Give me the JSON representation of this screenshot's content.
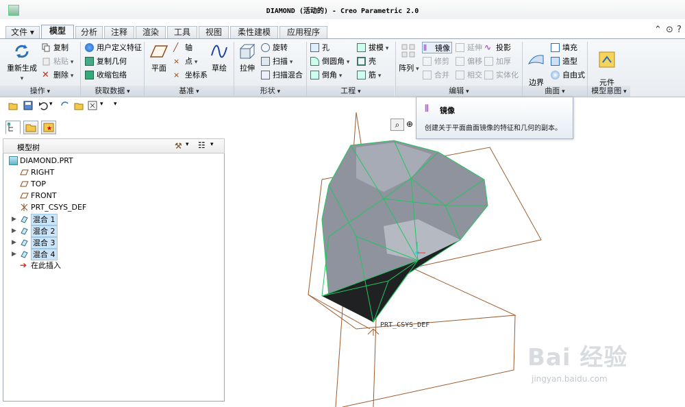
{
  "window": {
    "title": "DIAMOND (活动的) - Creo Parametric 2.0"
  },
  "menu_tabs": [
    "文件",
    "模型",
    "分析",
    "注释",
    "渲染",
    "工具",
    "视图",
    "柔性建模",
    "应用程序"
  ],
  "active_tab": "模型",
  "ribbon": {
    "operations": {
      "label": "操作",
      "regen": "重新生成",
      "copy": "复制",
      "paste": "粘贴",
      "delete": "删除"
    },
    "get_data": {
      "label": "获取数据",
      "udf": "用户定义特征",
      "copy_geom": "复制几何",
      "shrinkwrap": "收缩包络"
    },
    "datum": {
      "label": "基准",
      "plane": "平面",
      "axis": "轴",
      "point": "点",
      "csys": "坐标系",
      "sketch": "草绘"
    },
    "shapes": {
      "label": "形状",
      "extrude": "拉伸",
      "revolve": "旋转",
      "sweep": "扫描",
      "swept_blend": "扫描混合"
    },
    "engineering": {
      "label": "工程",
      "hole": "孔",
      "round": "倒圆角",
      "chamfer": "倒角",
      "draft": "拔模",
      "shell": "壳",
      "rib": "筋"
    },
    "edit": {
      "label": "编辑",
      "pattern": "阵列",
      "mirror": "镜像",
      "trim": "修剪",
      "merge": "合并",
      "extend": "延伸",
      "offset": "偏移",
      "intersect": "相交",
      "project": "投影",
      "thicken": "加厚",
      "solidify": "实体化"
    },
    "surfaces": {
      "label": "曲面",
      "boundary_blend": "边界\n混合",
      "fill": "填充",
      "style": "造型",
      "freestyle": "自由式"
    },
    "model_intent": {
      "label": "模型意图",
      "component_interface": "元件\n界面"
    }
  },
  "tooltip": {
    "title": "镜像",
    "desc": "创建关于平面曲面镜像的特征和几何的副本。"
  },
  "model_tree": {
    "title": "模型树",
    "root": "DIAMOND.PRT",
    "items": [
      "RIGHT",
      "TOP",
      "FRONT",
      "PRT_CSYS_DEF"
    ],
    "features": [
      "混合 1",
      "混合 2",
      "混合 3",
      "混合 4"
    ],
    "insert_here": "在此插入"
  },
  "viewport": {
    "csys_label": "PRT_CSYS_DEF"
  },
  "watermark": {
    "brand": "Bai  经验",
    "url": "jingyan.baidu.com"
  },
  "colors": {
    "datum": "#9b5a2a",
    "edges": "#22c55e",
    "body": "#8a8e99",
    "ribbon_bg": "#eef1f4"
  }
}
